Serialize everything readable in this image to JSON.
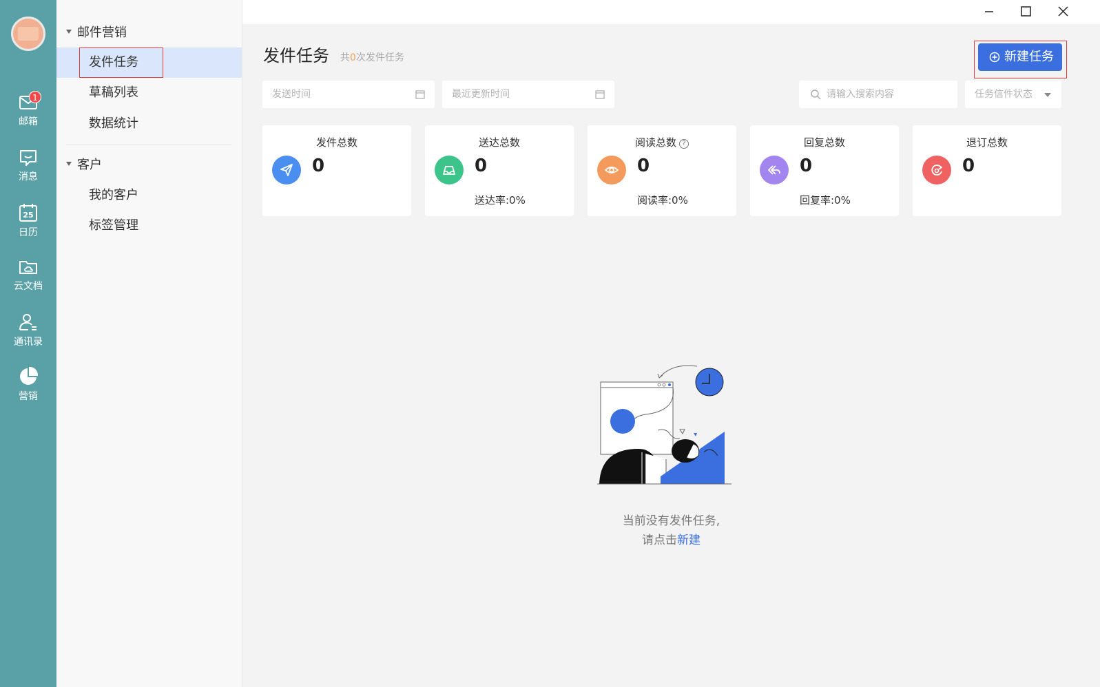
{
  "rail": {
    "items": [
      {
        "label": "邮箱",
        "icon": "mail-icon",
        "badge": "1"
      },
      {
        "label": "消息",
        "icon": "message-icon"
      },
      {
        "label": "日历",
        "icon": "calendar-icon",
        "day": "25"
      },
      {
        "label": "云文档",
        "icon": "cloud-folder-icon"
      },
      {
        "label": "通讯录",
        "icon": "contacts-icon"
      },
      {
        "label": "营销",
        "icon": "pie-chart-icon"
      }
    ]
  },
  "sidebar": {
    "groups": [
      {
        "title": "邮件营销",
        "items": [
          "发件任务",
          "草稿列表",
          "数据统计"
        ]
      },
      {
        "title": "客户",
        "items": [
          "我的客户",
          "标签管理"
        ]
      }
    ]
  },
  "main": {
    "title": "发件任务",
    "subtitle_prefix": "共",
    "subtitle_count": "0",
    "subtitle_suffix": "次发件任务",
    "new_button": "新建任务",
    "filters": {
      "send_time": "发送时间",
      "update_time": "最近更新时间",
      "search": "请输入搜索内容",
      "status": "任务信件状态"
    },
    "cards": [
      {
        "title": "发件总数",
        "value": "0",
        "rate": "",
        "color": "#4a8ef0"
      },
      {
        "title": "送达总数",
        "value": "0",
        "rate": "送达率:0%",
        "color": "#3cc48a"
      },
      {
        "title": "阅读总数",
        "value": "0",
        "rate": "阅读率:0%",
        "color": "#f39a5c",
        "help": "?"
      },
      {
        "title": "回复总数",
        "value": "0",
        "rate": "回复率:0%",
        "color": "#a385f0"
      },
      {
        "title": "退订总数",
        "value": "0",
        "rate": "",
        "color": "#f06262"
      }
    ],
    "empty": {
      "line1": "当前没有发件任务,",
      "line2_prefix": "请点击",
      "line2_link": "新建"
    }
  }
}
